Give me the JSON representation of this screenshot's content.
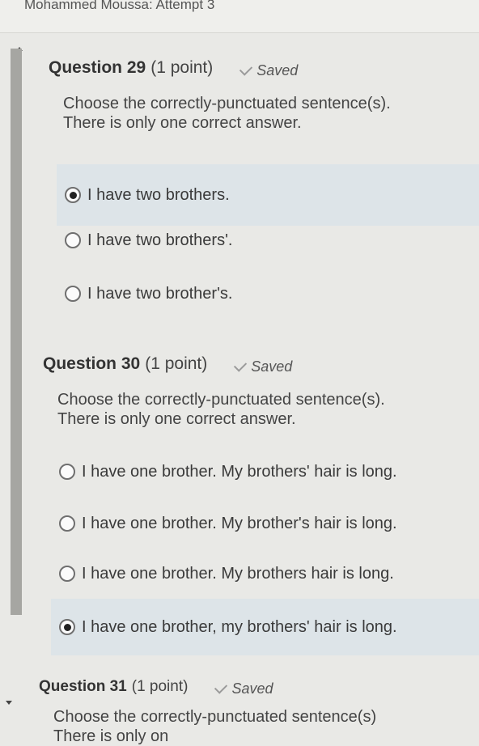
{
  "header": {
    "title": "Mohammed Moussa: Attempt 3"
  },
  "questions": [
    {
      "title": "Question 29",
      "points": "(1 point)",
      "status": "Saved",
      "prompt_line1": "Choose the correctly-punctuated sentence(s).",
      "prompt_line2": "There is only one correct answer.",
      "options": [
        {
          "label": "I have two brothers.",
          "selected": true
        },
        {
          "label": "I have two brothers'.",
          "selected": false
        },
        {
          "label": "I have two brother's.",
          "selected": false
        }
      ]
    },
    {
      "title": "Question 30",
      "points": "(1 point)",
      "status": "Saved",
      "prompt_line1": "Choose the correctly-punctuated sentence(s).",
      "prompt_line2": "There is only one correct answer.",
      "options": [
        {
          "label": "I have one brother. My brothers' hair is long.",
          "selected": false
        },
        {
          "label": "I have one brother. My brother's hair is long.",
          "selected": false
        },
        {
          "label": "I have one brother. My brothers hair is long.",
          "selected": false
        },
        {
          "label": "I have one brother, my brothers' hair is long.",
          "selected": true
        }
      ]
    },
    {
      "title": "Question 31",
      "points": "(1 point)",
      "status": "Saved",
      "prompt_line1": "Choose the correctly-punctuated sentence(s)",
      "prompt_line2": "There is only on"
    }
  ]
}
